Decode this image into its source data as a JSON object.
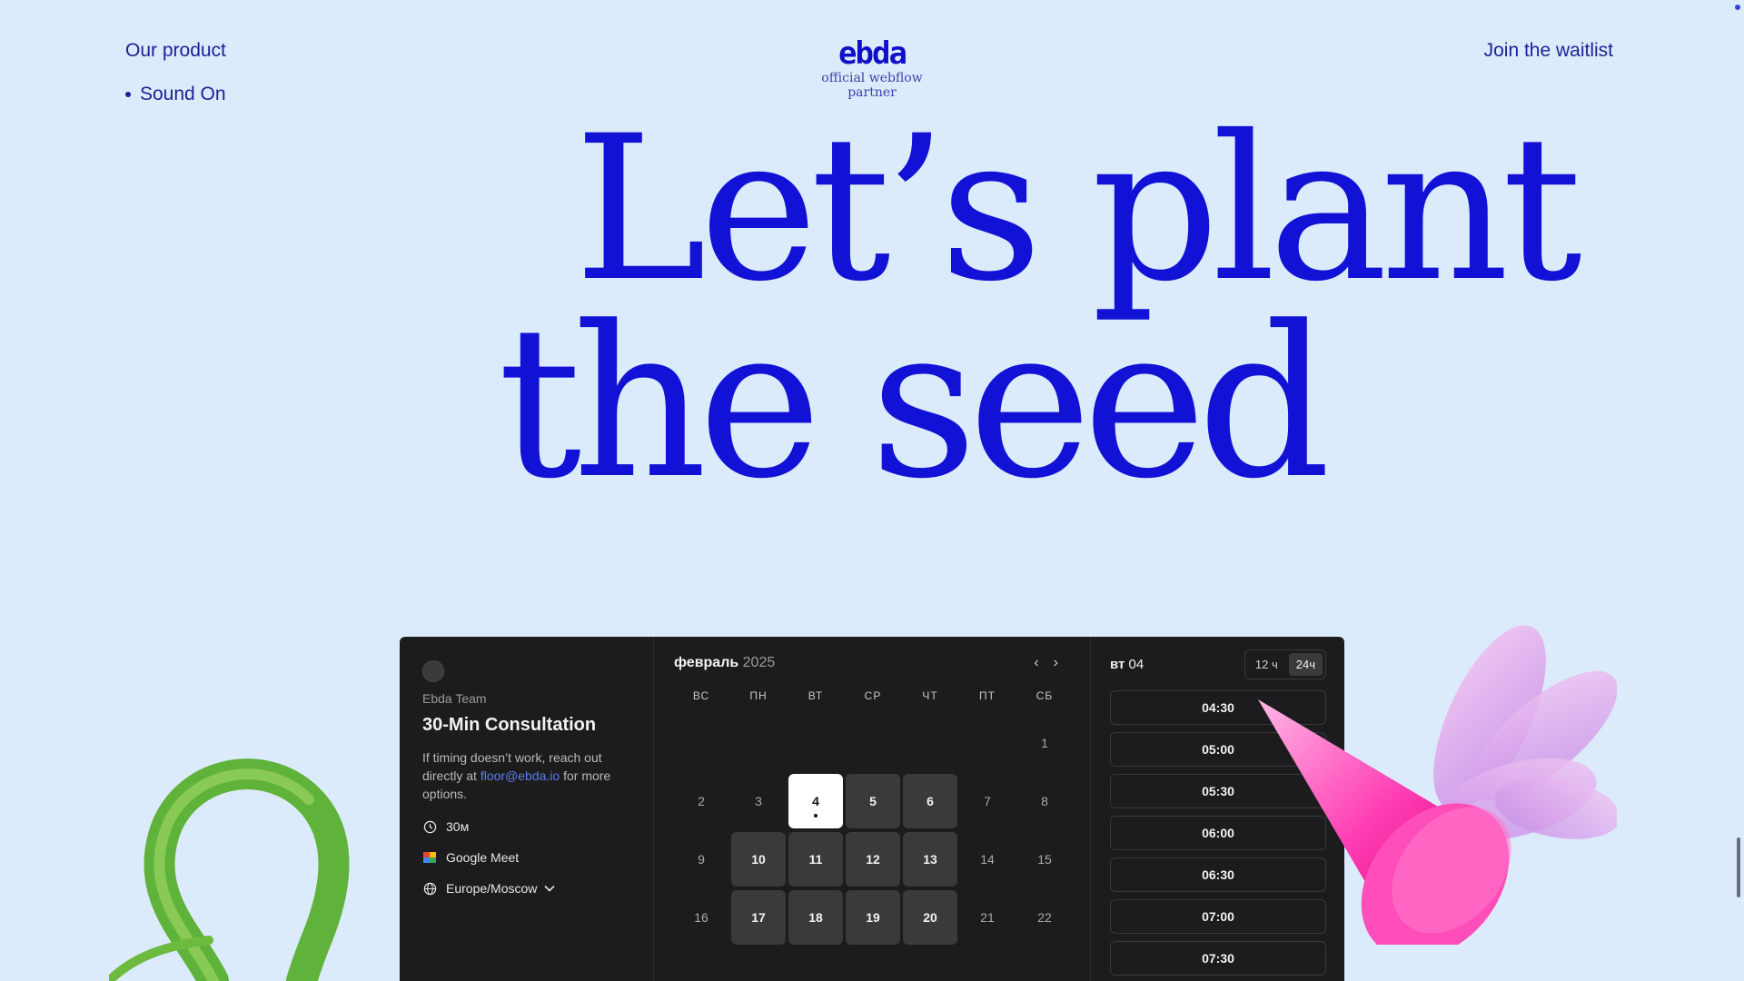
{
  "nav": {
    "product": "Our product",
    "sound": "Sound On",
    "logo": "ebda",
    "logo_sub": "official webflow partner",
    "waitlist": "Join the waitlist"
  },
  "hero": {
    "line1": "Let’s plant",
    "line2": "the seed"
  },
  "booking": {
    "team": "Ebda Team",
    "title": "30-Min Consultation",
    "desc_before": "If timing doesn’t work, reach out directly at ",
    "email": "floor@ebda.io",
    "desc_after": " for more options.",
    "duration": "30м",
    "platform": "Google Meet",
    "timezone": "Europe/Moscow",
    "month": "февраль",
    "year": "2025",
    "weekdays": [
      "ВС",
      "ПН",
      "ВТ",
      "СР",
      "ЧТ",
      "ПТ",
      "СБ"
    ],
    "weeks": [
      [
        "",
        "",
        "",
        "",
        "",
        "",
        "1"
      ],
      [
        "2",
        "3",
        "4",
        "5",
        "6",
        "7",
        "8"
      ],
      [
        "9",
        "10",
        "11",
        "12",
        "13",
        "14",
        "15"
      ],
      [
        "16",
        "17",
        "18",
        "19",
        "20",
        "21",
        "22"
      ]
    ],
    "available": [
      "5",
      "6",
      "10",
      "11",
      "12",
      "13",
      "17",
      "18",
      "19",
      "20"
    ],
    "selected": "4",
    "selected_label": "вт",
    "selected_num": "04",
    "format_12": "12 ч",
    "format_24": "24ч",
    "active_format": "24ч",
    "slots": [
      "04:30",
      "05:00",
      "05:30",
      "06:00",
      "06:30",
      "07:00",
      "07:30"
    ]
  },
  "colors": {
    "background": "#dcebfb",
    "brand": "#1212d6",
    "panel": "#1c1c1e"
  }
}
